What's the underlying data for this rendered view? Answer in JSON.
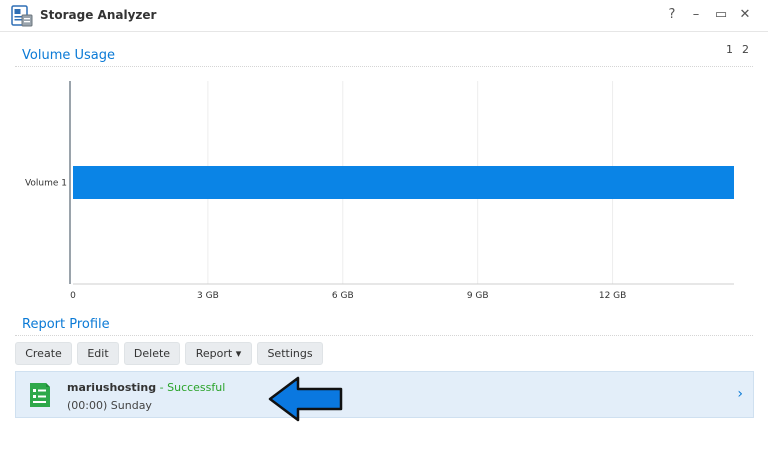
{
  "window": {
    "title": "Storage Analyzer",
    "help": "?",
    "minimize": "–",
    "maximize": "▭",
    "close": "✕"
  },
  "pager": {
    "pages": [
      "1",
      "2"
    ]
  },
  "volume_usage": {
    "title": "Volume Usage",
    "chart_data": {
      "type": "bar",
      "orientation": "horizontal",
      "categories": [
        "Volume 1"
      ],
      "values": [
        14.7
      ],
      "unit": "GB",
      "xlim": [
        0,
        14.7
      ],
      "ticks": [
        0,
        3,
        6,
        9,
        12
      ],
      "tick_labels": [
        "0",
        "3 GB",
        "6 GB",
        "9 GB",
        "12 GB"
      ],
      "grid": true,
      "color": "#0a84e6"
    }
  },
  "report_profile": {
    "title": "Report Profile",
    "buttons": {
      "create": "Create",
      "edit": "Edit",
      "delete": "Delete",
      "report": "Report ▾",
      "settings": "Settings"
    },
    "profile": {
      "name": "mariushosting",
      "separator": " - ",
      "status": "Successful",
      "schedule": "(00:00) Sunday",
      "status_color": "#2aa32a"
    }
  }
}
